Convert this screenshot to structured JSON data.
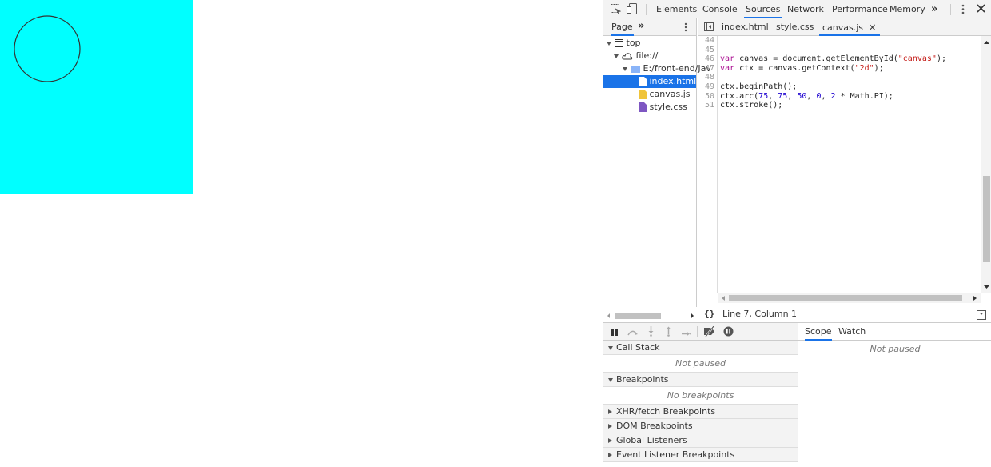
{
  "page": {
    "canvas_color": "#00ffff",
    "circle_color": "#333333"
  },
  "devtools": {
    "tabs": [
      "Elements",
      "Console",
      "Sources",
      "Network",
      "Performance",
      "Memory"
    ],
    "active_tab": "Sources",
    "more_tabs": "»",
    "navigator": {
      "tab": "Page",
      "more": "»",
      "tree": [
        "top",
        "file://",
        "E:/front-end/Jav",
        "index.html",
        "canvas.js",
        "style.css"
      ],
      "selected": "index.html"
    },
    "editor": {
      "tabs": [
        "index.html",
        "style.css",
        "canvas.js"
      ],
      "active": "canvas.js",
      "close": "×",
      "line_numbers": [
        "44",
        "45",
        "46",
        "47",
        "48",
        "49",
        "50",
        "51"
      ],
      "code": [
        "",
        "",
        "var canvas = document.getElementById(\"canvas\");",
        "var ctx = canvas.getContext(\"2d\");",
        "",
        "ctx.beginPath();",
        "ctx.arc(75, 75, 50, 0, 2 * Math.PI);",
        "ctx.stroke();"
      ],
      "status": "Line 7, Column 1",
      "braces": "{}"
    },
    "debugger": {
      "sections": [
        {
          "title": "Call Stack",
          "body": "Not paused",
          "expanded": true
        },
        {
          "title": "Breakpoints",
          "body": "No breakpoints",
          "expanded": true
        },
        {
          "title": "XHR/fetch Breakpoints",
          "expanded": false
        },
        {
          "title": "DOM Breakpoints",
          "expanded": false
        },
        {
          "title": "Global Listeners",
          "expanded": false
        },
        {
          "title": "Event Listener Breakpoints",
          "expanded": false
        }
      ],
      "right_tabs": [
        "Scope",
        "Watch"
      ],
      "right_active": "Scope",
      "right_body": "Not paused"
    },
    "accent": "#1a73e8"
  }
}
